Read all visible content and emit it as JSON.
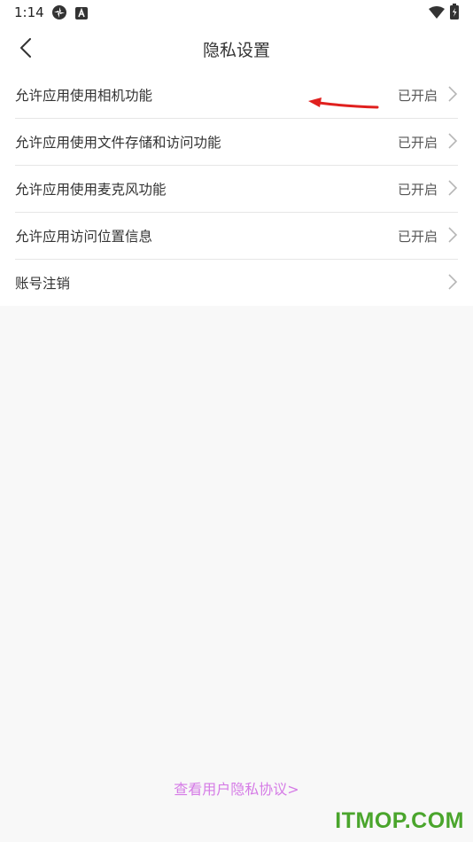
{
  "status_bar": {
    "time": "1:14",
    "icons": [
      "pinwheel-icon",
      "a-badge-icon",
      "wifi-icon",
      "battery-icon"
    ]
  },
  "header": {
    "title": "隐私设置",
    "back_icon": "chevron-left-icon"
  },
  "settings": [
    {
      "label": "允许应用使用相机功能",
      "status": "已开启"
    },
    {
      "label": "允许应用使用文件存储和访问功能",
      "status": "已开启"
    },
    {
      "label": "允许应用使用麦克风功能",
      "status": "已开启"
    },
    {
      "label": "允许应用访问位置信息",
      "status": "已开启"
    },
    {
      "label": "账号注销",
      "status": ""
    }
  ],
  "footer": {
    "agreement_link": "查看用户隐私协议>"
  },
  "watermark": "ITMOP.COM",
  "colors": {
    "link": "#d57be6",
    "watermark": "#4aa52c",
    "annotation_arrow": "#e0201e"
  }
}
